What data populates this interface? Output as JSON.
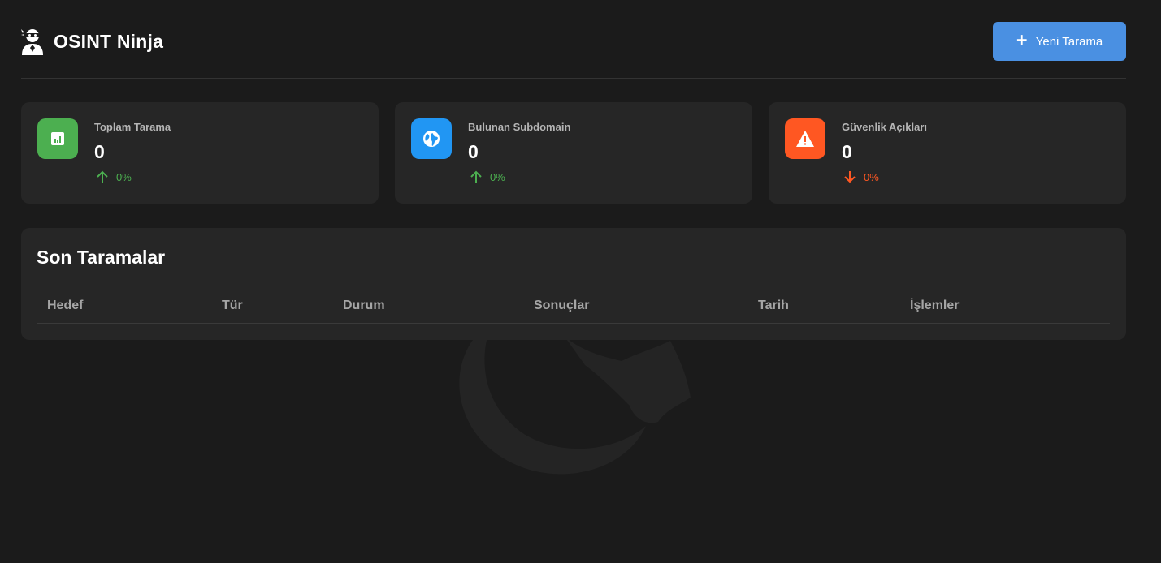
{
  "header": {
    "title": "OSINT Ninja",
    "new_scan_label": "Yeni Tarama",
    "logo_icon": "ninja-icon"
  },
  "stats": [
    {
      "label": "Toplam Tarama",
      "value": "0",
      "change": "0%",
      "trend": "up",
      "icon": "chart-icon",
      "color": "#4caf50",
      "trend_color": "#4caf50"
    },
    {
      "label": "Bulunan Subdomain",
      "value": "0",
      "change": "0%",
      "trend": "up",
      "icon": "globe-icon",
      "color": "#2196f3",
      "trend_color": "#4caf50"
    },
    {
      "label": "Güvenlik Açıkları",
      "value": "0",
      "change": "0%",
      "trend": "down",
      "icon": "warning-icon",
      "color": "#ff5722",
      "trend_color": "#ff5722"
    }
  ],
  "recent_scans": {
    "title": "Son Taramalar",
    "columns": [
      "Hedef",
      "Tür",
      "Durum",
      "Sonuçlar",
      "Tarih",
      "İşlemler"
    ],
    "rows": []
  }
}
